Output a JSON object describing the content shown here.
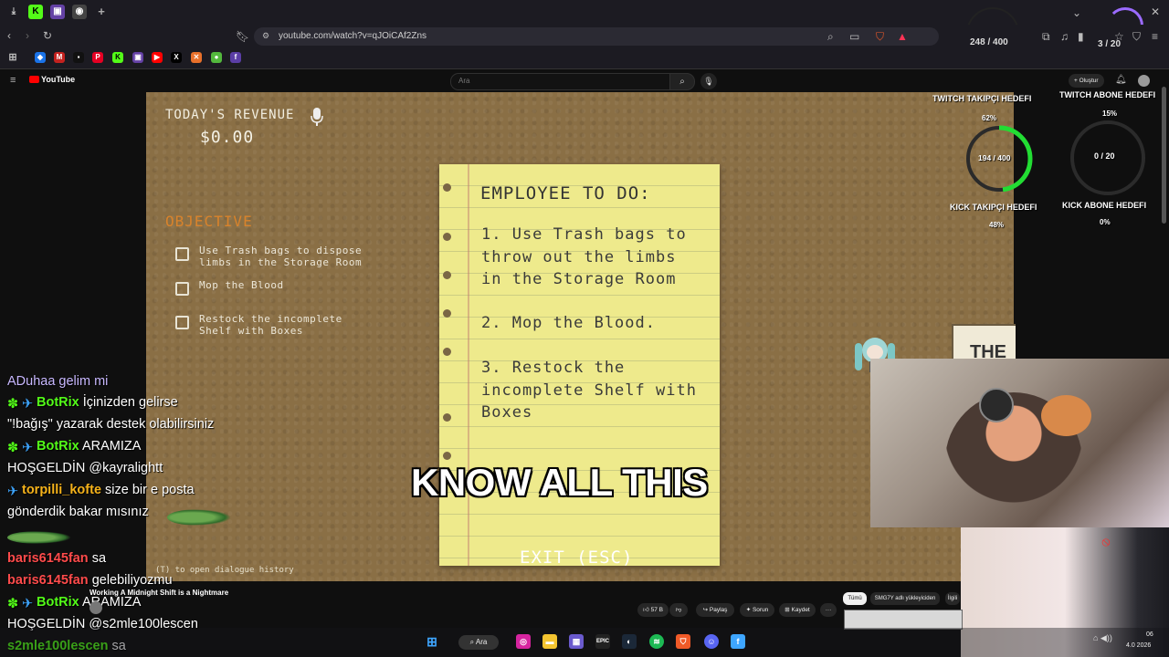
{
  "browser": {
    "url": "youtube.com/watch?v=qJOiCAf2Zns",
    "counter_left": "248 / 400",
    "counter_right": "3 / 20"
  },
  "youtube": {
    "logo": "YouTube",
    "search_placeholder": "Ara",
    "create_label": "+ Oluştur"
  },
  "game": {
    "revenue_label": "TODAY'S REVENUE",
    "revenue_value": "$0.00",
    "objective_label": "OBJECTIVE",
    "objectives": [
      "Use Trash bags to dispose\nlimbs in the Storage Room",
      "Mop the Blood",
      "Restock the incomplete\nShelf with Boxes"
    ],
    "note_title": "EMPLOYEE TO DO:",
    "note_items": [
      "1. Use Trash bags to\nthrow out the limbs\nin the Storage Room",
      "2. Mop the Blood.",
      "3. Restock the\nincomplete Shelf with\nBoxes"
    ],
    "caption": "KNOW ALL THIS",
    "exit_label": "EXIT (ESC)",
    "dialog_hint": "(T) to open dialogue history",
    "board_text": "THE"
  },
  "overlay": {
    "twitch_follow_title": "TWITCH TAKIPÇI HEDEFI",
    "twitch_follow_pct": "62%",
    "follow_count": "194 / 400",
    "kick_follow_title": "KICK TAKIPÇI HEDEFI",
    "kick_follow_pct": "48%",
    "twitch_sub_title": "TWITCH ABONE HEDEFI",
    "twitch_sub_pct": "15%",
    "sub_count": "0 / 20",
    "kick_sub_title": "KICK ABONE HEDEFI",
    "kick_sub_pct": "0%",
    "follow_progress": 0.48,
    "colors": {
      "ring_green": "#22dd33",
      "ring_gray": "#3a3a3a",
      "purple": "#9b6bff"
    }
  },
  "chat": [
    {
      "user": "",
      "text": "ADuhaa gelim mi",
      "color": "#c8b8ff"
    },
    {
      "user": "BotRix",
      "text": " İçinizden gelirse",
      "color": "#53fc18",
      "badges": true
    },
    {
      "user": "",
      "text": "\"!bağış\" yazarak destek olabilirsiniz"
    },
    {
      "user": "BotRix",
      "text": " ARAMIZA",
      "color": "#53fc18",
      "badges": true
    },
    {
      "user": "",
      "text": "HOŞGELDİN @kayralightt"
    },
    {
      "user": "torpilli_kofte",
      "text": " size bir e posta",
      "color": "#f5b21a",
      "badge_one": true
    },
    {
      "user": "",
      "text": "gönderdik bakar mısınız"
    },
    {
      "user": "baris6145fan",
      "text": " sa",
      "color": "#ff4b4b"
    },
    {
      "user": "baris6145fan",
      "text": " gelebiliyozmu",
      "color": "#ff4b4b"
    },
    {
      "user": "BotRix",
      "text": " ARAMIZA",
      "color": "#53fc18",
      "badges": true
    },
    {
      "user": "",
      "text": "HOŞGELDİN @s2mle100lescen"
    },
    {
      "user": "s2mle100lescen",
      "text": " sa",
      "color": "#53fc18"
    }
  ],
  "video": {
    "title": "Working A Midnight Shift is a Nightmare",
    "likes": "57 B",
    "share": "Paylaş",
    "ask": "Sorun",
    "save": "Kaydet",
    "chip_all": "Tümü",
    "chip_2": "SMG7Y adlı yükleyiciden",
    "chip_3": "İlgili"
  },
  "taskbar": {
    "search_label": "Ara",
    "time": "06",
    "date": "4.0 2026"
  }
}
